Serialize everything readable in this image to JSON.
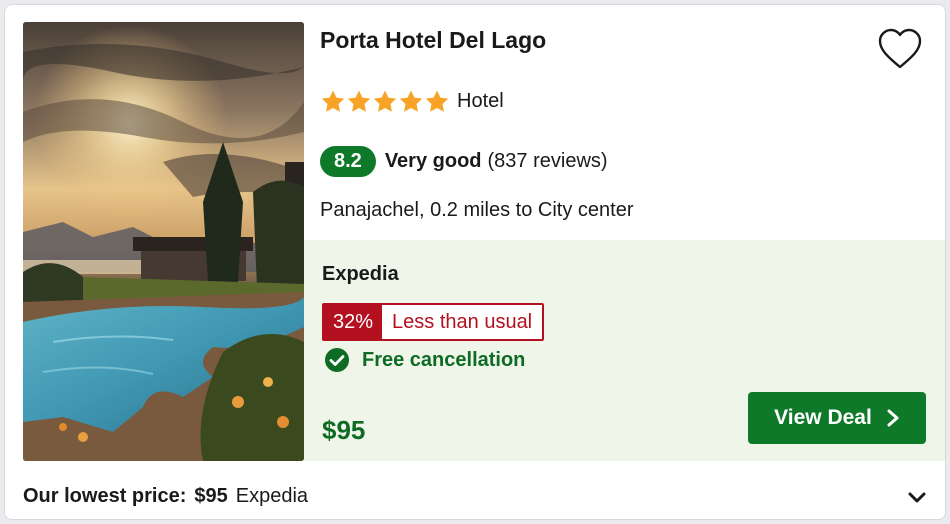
{
  "hotel": {
    "name": "Porta Hotel Del Lago",
    "stars": 5,
    "property_type": "Hotel",
    "score": "8.2",
    "rating_word": "Very good",
    "reviews": "(837 reviews)",
    "location": "Panajachel, 0.2 miles to City center"
  },
  "deal": {
    "provider": "Expedia",
    "discount_pct": "32%",
    "discount_label": "Less than usual",
    "cancellation": "Free cancellation",
    "price": "$95",
    "cta_label": "View Deal"
  },
  "footer": {
    "lowest_label": "Our lowest price:",
    "lowest_amount": "$95",
    "lowest_provider": "Expedia"
  },
  "icons": {
    "favorite": "heart-outline-icon",
    "star": "star-icon",
    "check": "check-circle-icon",
    "chevron_right": "chevron-right-icon",
    "chevron_down": "chevron-down-icon"
  },
  "colors": {
    "accent_green": "#0e7a29",
    "deal_background": "#eff6e9",
    "discount_red": "#b3111f",
    "star_orange": "#f7a325"
  }
}
